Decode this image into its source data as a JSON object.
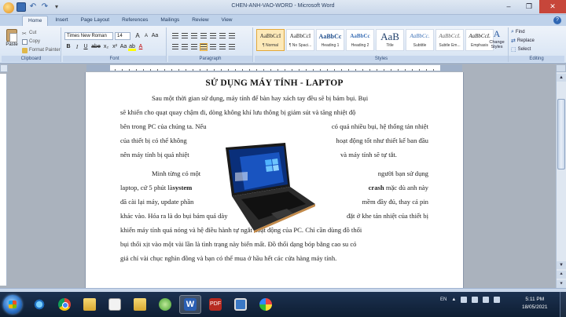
{
  "window": {
    "title": "CHEN-ANH-VAO-WORD - Microsoft Word"
  },
  "tabs": [
    "Home",
    "Insert",
    "Page Layout",
    "References",
    "Mailings",
    "Review",
    "View"
  ],
  "clipboard": {
    "paste_label": "Paste",
    "cut_label": "Cut",
    "copy_label": "Copy",
    "format_painter_label": "Format Painter",
    "group_label": "Clipboard"
  },
  "font": {
    "family": "Times New Roman",
    "size": "14",
    "grow": "A",
    "shrink": "A",
    "clear": "Aa",
    "bold": "B",
    "italic": "I",
    "underline": "U",
    "strike": "abe",
    "subscript": "x₂",
    "superscript": "x²",
    "change_case": "Aa",
    "highlight": "ab",
    "color": "A",
    "group_label": "Font"
  },
  "paragraph": {
    "group_label": "Paragraph"
  },
  "styles": {
    "items": [
      {
        "sample": "AaBbCcI",
        "name": "¶ Normal"
      },
      {
        "sample": "AaBbCcI",
        "name": "¶ No Spaci..."
      },
      {
        "sample": "AaBbCc",
        "name": "Heading 1"
      },
      {
        "sample": "AaBbCc",
        "name": "Heading 2"
      },
      {
        "sample": "AaB",
        "name": "Title"
      },
      {
        "sample": "AaBbCc.",
        "name": "Subtitle"
      },
      {
        "sample": "AaBbCcL",
        "name": "Subtle Em..."
      },
      {
        "sample": "AaBbCcL",
        "name": "Emphasis"
      }
    ],
    "change_styles_label": "Change Styles",
    "group_label": "Styles"
  },
  "editing": {
    "find_label": "Find",
    "replace_label": "Replace",
    "select_label": "Select",
    "group_label": "Editing"
  },
  "document": {
    "title": "SỬ DỤNG MÁY TÍNH - LAPTOP",
    "lines": [
      [
        "Sau một thời gian sử dụng, máy tính để bàn hay xách tay đều sẽ bị bám bụi. Bụi"
      ],
      [
        "sẽ khiến cho quạt quay chậm đi, dòng không khí lưu thông bị giảm sút và tăng nhiệt độ"
      ],
      [
        "bên trong PC của chúng ta. Nếu",
        "có quá nhiều bụi, hệ thống tản nhiệt"
      ],
      [
        "của thiết bị có thể không",
        "hoạt động tốt như thiết kế ban đầu"
      ],
      [
        "nên máy tính bị quá nhiệt",
        "và máy tính sẽ tự tắt."
      ],
      [
        "Minh từng có một",
        "người bạn sử dụng"
      ],
      [
        "laptop, cứ 5 phút là",
        "system",
        "crash",
        "mặc dù anh này"
      ],
      [
        "đã cài lại máy, update phần",
        "mềm đầy đủ, thay cả pin"
      ],
      [
        "khác vào. Hóa ra là do bụi bám quá dày",
        "đặt ở khe tản nhiệt của thiết bị"
      ],
      [
        "khiến máy tính quá nóng và hệ điều hành tự ngắt hoạt động của PC. Chỉ cần dùng đồ thổi"
      ],
      [
        "bụi thổi xịt vào một vài lần là tình trạng này biến mất. Đồ thổi dạng bóp bằng cao su có"
      ],
      [
        "giá chỉ vài chục nghìn đồng và bạn có thể mua ở hầu hết các cửa hàng máy tính."
      ]
    ]
  },
  "taskbar": {
    "language": "EN",
    "time": "5:11 PM",
    "date": "18/05/2021",
    "apps": [
      {
        "icon": "internet-explorer-icon"
      },
      {
        "icon": "chrome-icon"
      },
      {
        "icon": "file-explorer-icon"
      },
      {
        "icon": "blank-window-icon"
      },
      {
        "icon": "word-icon",
        "label": "W"
      },
      {
        "icon": "pdf-icon",
        "label": "PDF"
      },
      {
        "icon": "green-app-icon"
      },
      {
        "icon": "remote-desktop-icon"
      },
      {
        "icon": "paint-icon"
      }
    ]
  },
  "colors": {
    "ribbon_bg": "#dfe8f4",
    "taskbar_bg": "#152840",
    "word_blue": "#2b5fb3"
  }
}
